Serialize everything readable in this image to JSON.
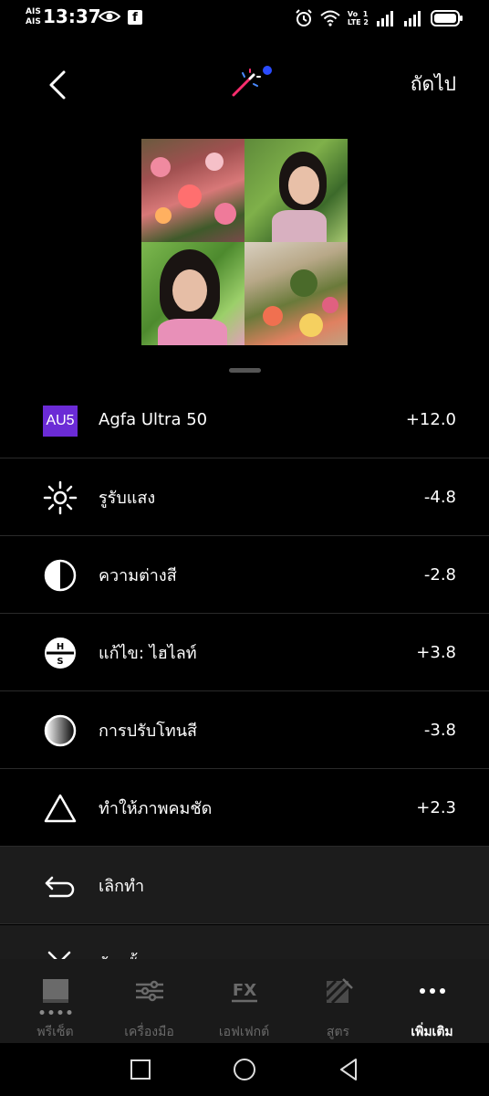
{
  "status": {
    "carrier1": "AIS",
    "carrier2": "AIS",
    "time": "13:37",
    "volte_top": "Vo",
    "volte_bottom": "LTE",
    "sim1": "1",
    "sim2": "2"
  },
  "header": {
    "next_label": "ถัดไป"
  },
  "adjustments": [
    {
      "badge": "AU5",
      "label": "Agfa Ultra 50",
      "value": "+12.0",
      "icon": "preset-badge"
    },
    {
      "label": "รูรับแสง",
      "value": "-4.8",
      "icon": "sun-icon"
    },
    {
      "label": "ความต่างสี",
      "value": "-2.8",
      "icon": "contrast-icon"
    },
    {
      "label": "แก้ไข: ไฮไลท์",
      "value": "+3.8",
      "icon": "highlights-icon"
    },
    {
      "label": "การปรับโทนสี",
      "value": "-3.8",
      "icon": "tone-icon"
    },
    {
      "label": "ทำให้ภาพคมชัด",
      "value": "+2.3",
      "icon": "sharpen-triangle-icon"
    }
  ],
  "undo_label": "เลิกทำ",
  "peek_label": "ล้างทั้งหมด",
  "nav": {
    "presets": "พรีเซ็ต",
    "tools": "เครื่องมือ",
    "effects": "เอฟเฟกต์",
    "recipes": "สูตร",
    "more": "เพิ่มเติม",
    "fx_glyph": "FX"
  },
  "colors": {
    "accent_purple": "#6b2bd6",
    "accent_blue": "#2a4bff"
  }
}
